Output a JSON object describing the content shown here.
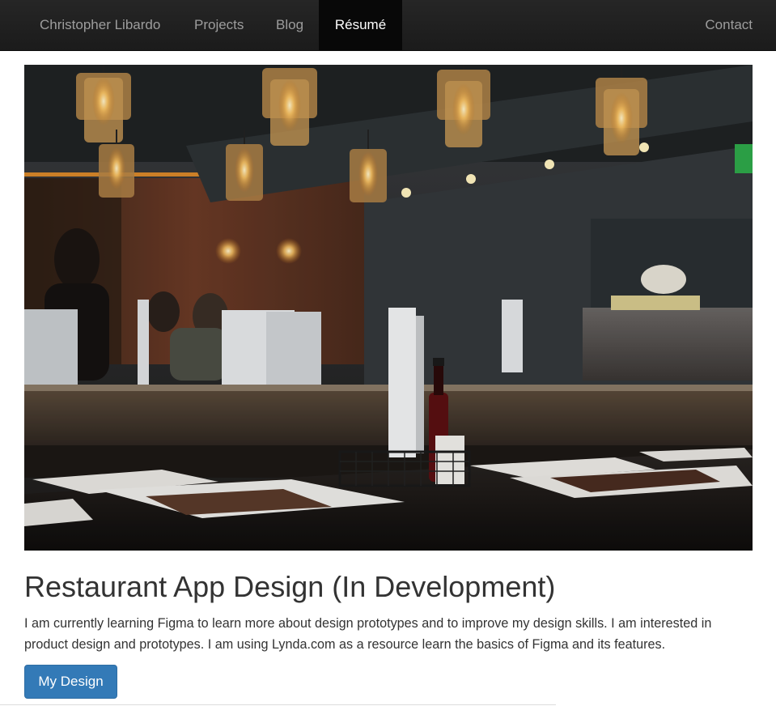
{
  "navbar": {
    "brand": "Christopher Libardo",
    "items": [
      {
        "label": "Projects"
      },
      {
        "label": "Blog"
      },
      {
        "label": "Résumé",
        "active": true
      }
    ],
    "right_item": "Contact"
  },
  "project": {
    "image_description": "restaurant-interior-photo",
    "title": "Restaurant App Design (In Development)",
    "description": "I am currently learning Figma to learn more about design prototypes and to improve my design skills. I am interested in product design and prototypes. I am using Lynda.com as a resource learn the basics of Figma and its features.",
    "button_label": "My Design"
  },
  "colors": {
    "navbar_bg": "#222222",
    "nav_text": "#9d9d9d",
    "nav_active_bg": "#080808",
    "nav_active_text": "#ffffff",
    "primary_button": "#337ab7",
    "body_text": "#333333"
  }
}
